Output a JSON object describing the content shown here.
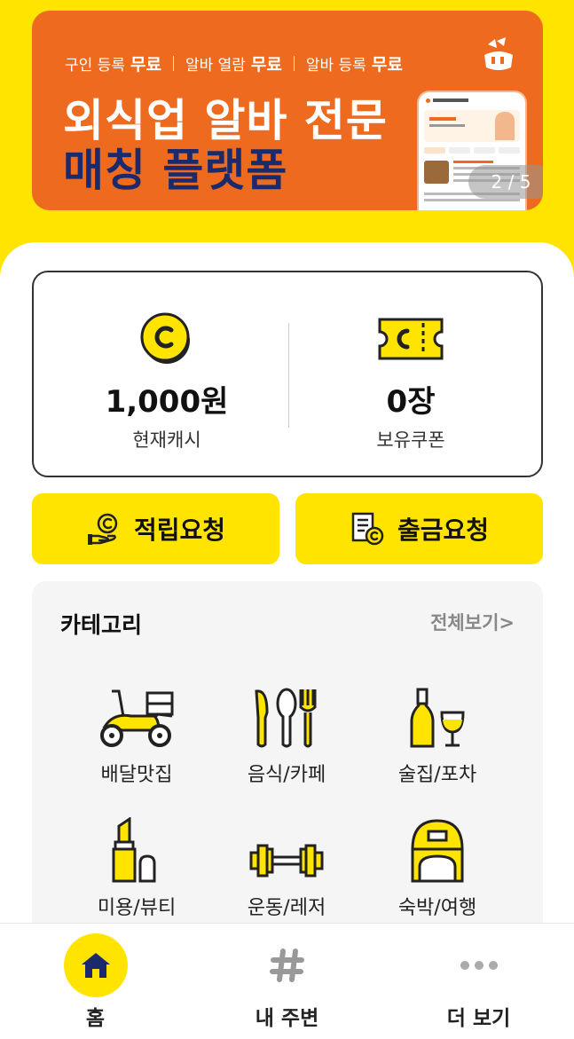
{
  "banner": {
    "tags": [
      {
        "label": "구인 등록",
        "badge": "무료"
      },
      {
        "label": "알바 열람",
        "badge": "무료"
      },
      {
        "label": "알바 등록",
        "badge": "무료"
      }
    ],
    "title_line1": "외식업 알바 전문",
    "title_line2": "매칭 플랫폼",
    "pager": "2 / 5"
  },
  "wallet": {
    "cash_value": "1,000원",
    "cash_label": "현재캐시",
    "coupon_value": "0장",
    "coupon_label": "보유쿠폰"
  },
  "actions": {
    "earn_label": "적립요청",
    "withdraw_label": "출금요청"
  },
  "category": {
    "title": "카테고리",
    "more_label": "전체보기>",
    "items": [
      {
        "label": "배달맛집",
        "icon": "scooter-icon"
      },
      {
        "label": "음식/카페",
        "icon": "cutlery-icon"
      },
      {
        "label": "술집/포차",
        "icon": "wine-icon"
      },
      {
        "label": "미용/뷰티",
        "icon": "lipstick-icon"
      },
      {
        "label": "운동/레저",
        "icon": "dumbbell-icon"
      },
      {
        "label": "숙박/여행",
        "icon": "backpack-icon"
      }
    ]
  },
  "bottom_nav": {
    "items": [
      {
        "label": "홈",
        "icon": "home-icon",
        "active": true
      },
      {
        "label": "내 주변",
        "icon": "hash-icon",
        "active": false
      },
      {
        "label": "더 보기",
        "icon": "more-icon",
        "active": false
      }
    ]
  },
  "colors": {
    "brand_yellow": "#FFE400",
    "banner_orange": "#EE6A1E",
    "banner_navy": "#1A2A6C"
  }
}
